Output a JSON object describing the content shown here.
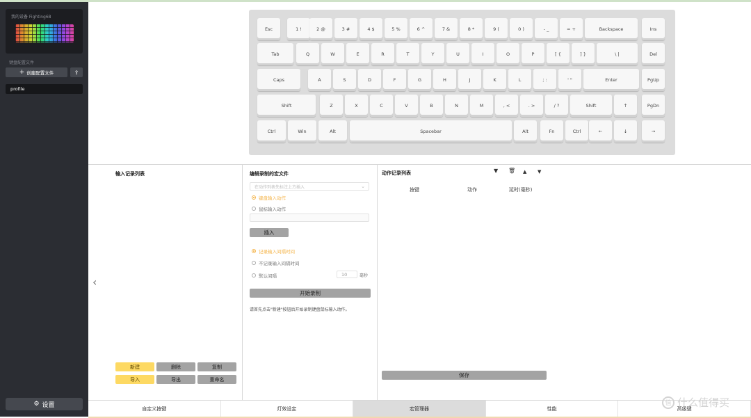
{
  "sidebar": {
    "device_title": "我的设备 Fighting68",
    "section_label": "键盘配置文件",
    "create_label": "创建配置文件",
    "create_icon": "plus-icon",
    "upload_icon": "upload-icon",
    "profile": "profile",
    "settings_label": "设置",
    "settings_icon": "gear-icon"
  },
  "keyboard": {
    "rows": [
      [
        "Esc",
        "1 !",
        "2 @",
        "3 #",
        "4 $",
        "5 %",
        "6 ^",
        "7 &",
        "8 *",
        "9 (",
        "0 )",
        "- _",
        "= +",
        "Backspace",
        "Ins"
      ],
      [
        "Tab",
        "Q",
        "W",
        "E",
        "R",
        "T",
        "Y",
        "U",
        "I",
        "O",
        "P",
        "[ {",
        "] }",
        "\\ |",
        "Del"
      ],
      [
        "Caps",
        "A",
        "S",
        "D",
        "F",
        "G",
        "H",
        "J",
        "K",
        "L",
        "; :",
        "' \"",
        "Enter",
        "PgUp"
      ],
      [
        "Shift",
        "Z",
        "X",
        "C",
        "V",
        "B",
        "N",
        "M",
        ", <",
        ". >",
        "/ ?",
        "Shift",
        "↑",
        "PgDn"
      ],
      [
        "Ctrl",
        "Win",
        "Alt",
        "Spacebar",
        "Alt",
        "Fn",
        "Ctrl",
        "←",
        "↓",
        "→"
      ]
    ]
  },
  "left_panel": {
    "title": "输入记录列表",
    "buttons": {
      "new": "新建",
      "delete": "删除",
      "copy": "复制",
      "import": "导入",
      "export": "导出",
      "rename": "重命名"
    }
  },
  "mid_panel": {
    "title": "编辑录制的宏文件",
    "select_placeholder": "在动作列表先标注上方插入",
    "radio_keyboard": "键盘输入动作",
    "radio_mouse": "鼠标输入动作",
    "insert_label": "插入",
    "radio_record_interval": "记录输入间隔时间",
    "radio_no_interval": "不记录输入间隔时间",
    "radio_default_interval": "默认间隔",
    "default_interval_value": "10",
    "ms_label": "毫秒",
    "start_label": "开始录制",
    "hint": "请首先点击\"新建\"按钮后开始录制键盘鼠标输入动作。"
  },
  "right_panel": {
    "title": "动作记录列表",
    "columns": [
      "按键",
      "动作",
      "延时(毫秒)"
    ],
    "save_label": "保存",
    "icons": [
      "pin-icon",
      "trash-icon",
      "arrow-up-icon",
      "arrow-down-icon"
    ]
  },
  "tabs": [
    "自定义按键",
    "灯效设定",
    "宏管理器",
    "性能",
    "高级键"
  ],
  "active_tab": "宏管理器",
  "watermark": {
    "badge": "值",
    "text": "什么值得买"
  }
}
